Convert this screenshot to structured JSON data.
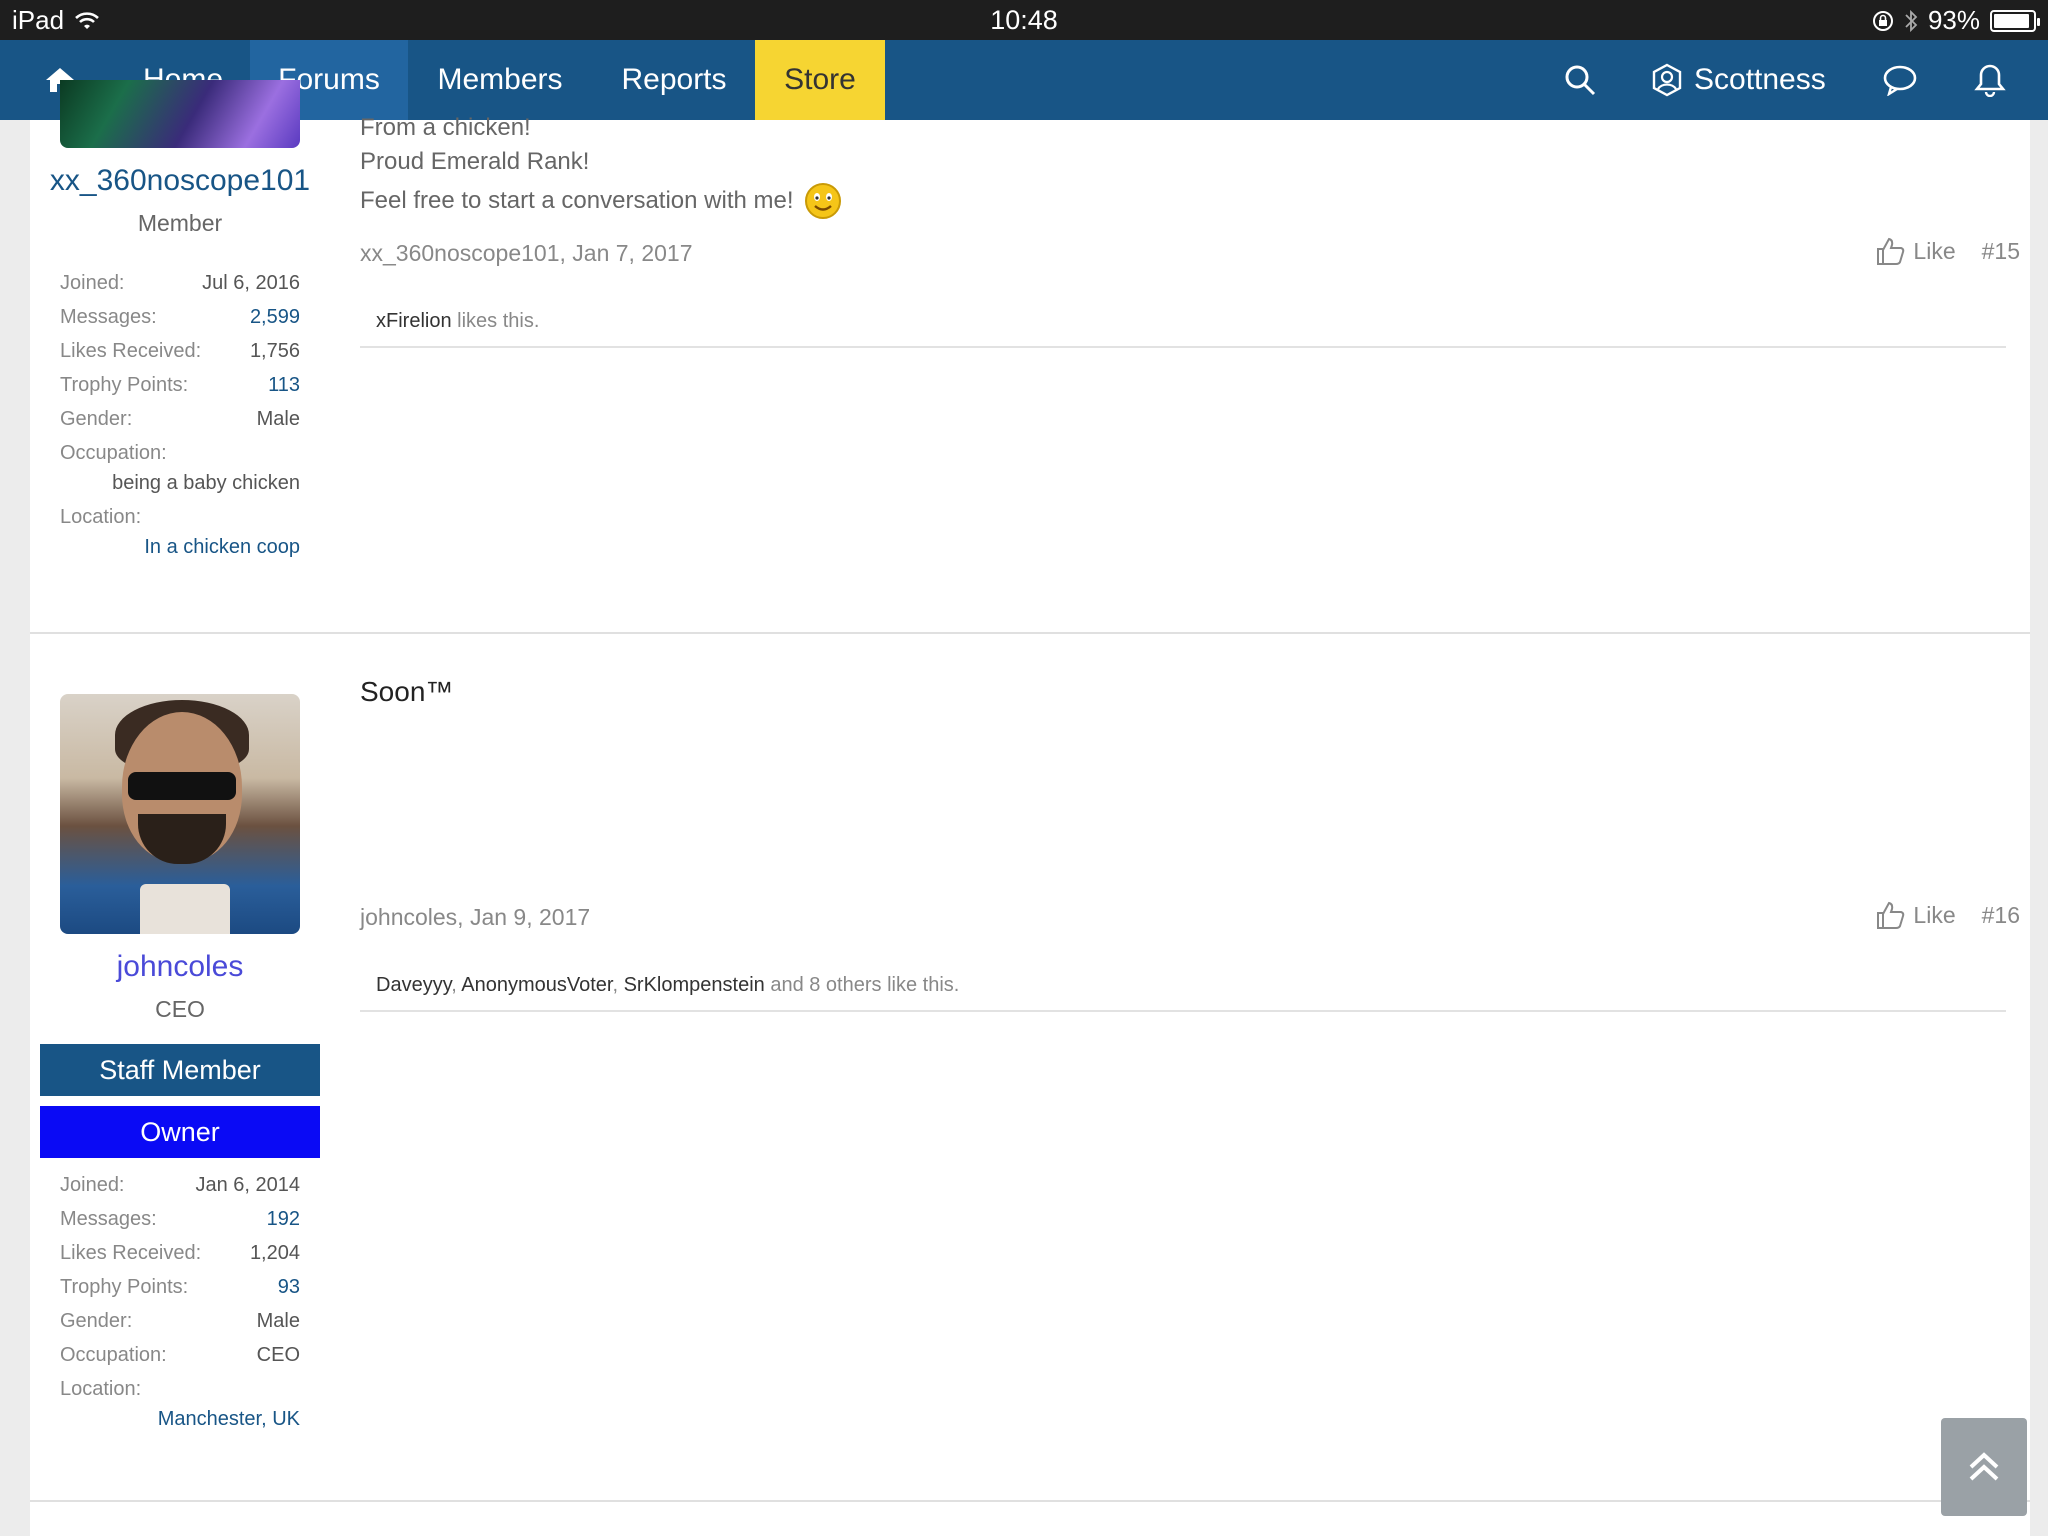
{
  "status_bar": {
    "device": "iPad",
    "time": "10:48",
    "battery": "93%",
    "battery_level": 0.93
  },
  "nav": {
    "items": [
      {
        "label": "Home"
      },
      {
        "label": "Forums"
      },
      {
        "label": "Members"
      },
      {
        "label": "Reports"
      },
      {
        "label": "Store"
      }
    ],
    "username": "Scottness"
  },
  "posts": [
    {
      "username": "xx_360noscope101",
      "user_title": "Member",
      "stats": {
        "joined_label": "Joined:",
        "joined": "Jul 6, 2016",
        "messages_label": "Messages:",
        "messages": "2,599",
        "likes_label": "Likes Received:",
        "likes": "1,756",
        "trophy_label": "Trophy Points:",
        "trophy": "113",
        "gender_label": "Gender:",
        "gender": "Male",
        "occupation_label": "Occupation:",
        "occupation": "being a baby chicken",
        "location_label": "Location:",
        "location": "In a chicken coop"
      },
      "signature": [
        "From a chicken!",
        "Proud Emerald Rank!",
        "Feel free to start a conversation with me!"
      ],
      "meta": "xx_360noscope101, Jan 7, 2017",
      "like_label": "Like",
      "post_number": "#15",
      "likes_names": [
        "xFirelion"
      ],
      "likes_suffix": " likes this."
    },
    {
      "username": "johncoles",
      "user_title": "CEO",
      "badges": [
        "Staff Member",
        "Owner"
      ],
      "stats": {
        "joined_label": "Joined:",
        "joined": "Jan 6, 2014",
        "messages_label": "Messages:",
        "messages": "192",
        "likes_label": "Likes Received:",
        "likes": "1,204",
        "trophy_label": "Trophy Points:",
        "trophy": "93",
        "gender_label": "Gender:",
        "gender": "Male",
        "occupation_label": "Occupation:",
        "occupation": "CEO",
        "location_label": "Location:",
        "location": "Manchester, UK"
      },
      "message": "Soon™",
      "meta": "johncoles, Jan 9, 2017",
      "like_label": "Like",
      "post_number": "#16",
      "likes_names": [
        "Daveyyy",
        "AnonymousVoter",
        "SrKlompenstein"
      ],
      "likes_sep": ", ",
      "likes_suffix": " and 8 others like this."
    }
  ]
}
